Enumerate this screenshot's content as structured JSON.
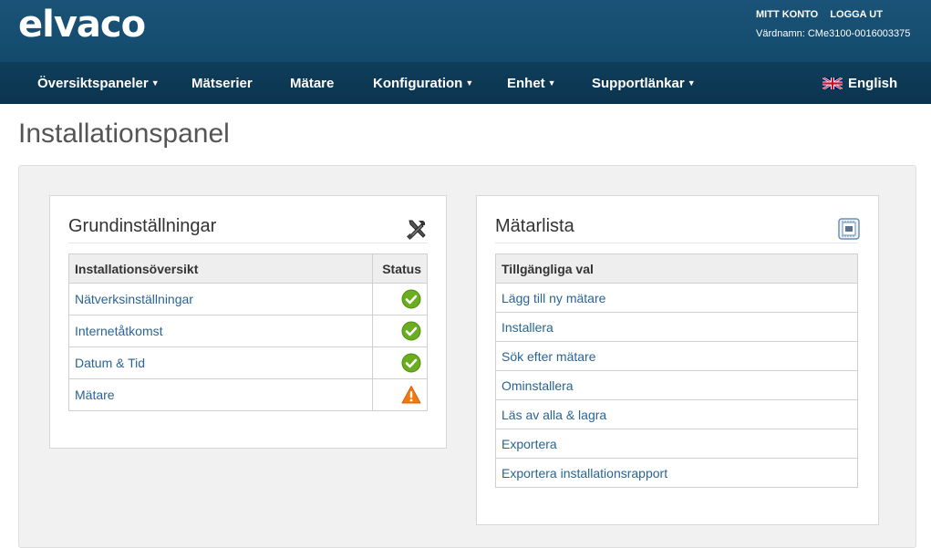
{
  "header": {
    "logo_text": "elvaco",
    "my_account": "MITT KONTO",
    "logout": "LOGGA UT",
    "hostname": "Värdnamn: CMe3100-0016003375"
  },
  "nav": {
    "items": [
      {
        "label": "Översiktspaneler",
        "dropdown": true
      },
      {
        "label": "Mätserier",
        "dropdown": false
      },
      {
        "label": "Mätare",
        "dropdown": false
      },
      {
        "label": "Konfiguration",
        "dropdown": true
      },
      {
        "label": "Enhet",
        "dropdown": true
      },
      {
        "label": "Supportlänkar",
        "dropdown": true
      }
    ],
    "language": "English"
  },
  "page": {
    "title": "Installationspanel"
  },
  "basic_settings": {
    "title": "Grundinställningar",
    "icon": "tools-icon",
    "col_overview": "Installationsöversikt",
    "col_status": "Status",
    "rows": [
      {
        "label": "Nätverksinställningar",
        "status": "ok"
      },
      {
        "label": "Internetåtkomst",
        "status": "ok"
      },
      {
        "label": "Datum & Tid",
        "status": "ok"
      },
      {
        "label": "Mätare",
        "status": "warning"
      }
    ]
  },
  "meter_list": {
    "title": "Mätarlista",
    "icon": "meter-icon",
    "col_options": "Tillgängliga val",
    "rows": [
      {
        "label": "Lägg till ny mätare"
      },
      {
        "label": "Installera"
      },
      {
        "label": "Sök efter mätare"
      },
      {
        "label": "Ominstallera"
      },
      {
        "label": "Läs av alla & lagra"
      },
      {
        "label": "Exportera"
      },
      {
        "label": "Exportera installationsrapport"
      }
    ]
  },
  "colors": {
    "header_bg": "#1b5378",
    "nav_bg": "#0f3e5a",
    "link": "#2a6496",
    "ok_green": "#6aad1e",
    "warning_orange": "#f07a10"
  }
}
